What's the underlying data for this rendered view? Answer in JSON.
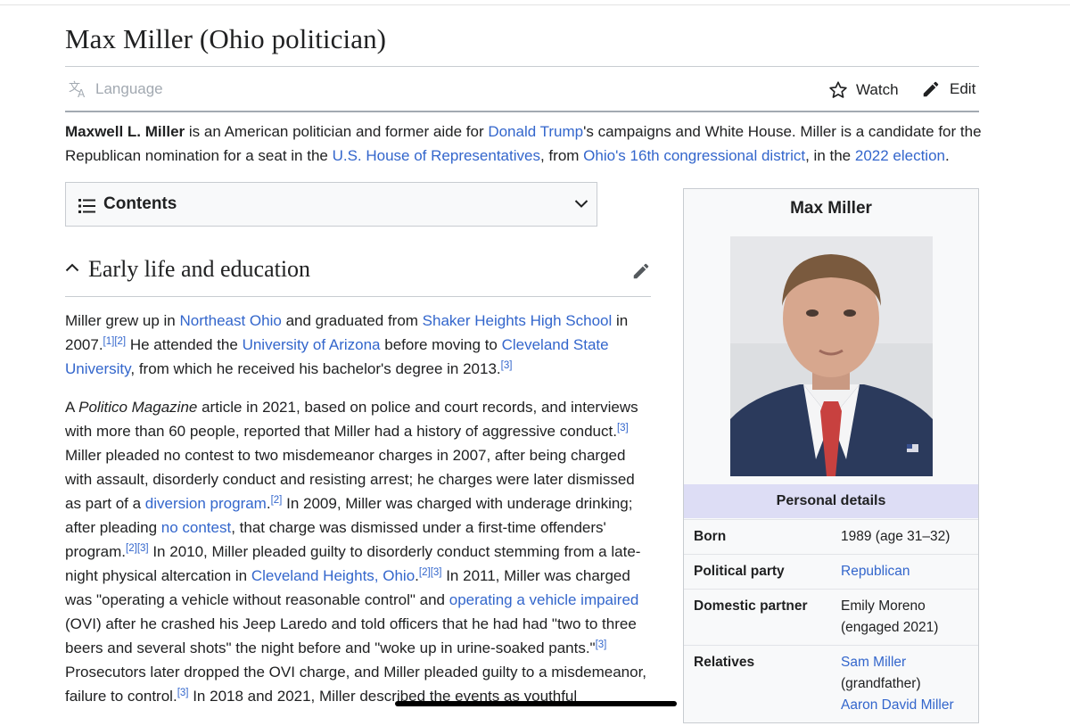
{
  "page": {
    "title": "Max Miller (Ohio politician)"
  },
  "toolbar": {
    "language_label": "Language",
    "watch_label": "Watch",
    "edit_label": "Edit"
  },
  "lead": {
    "name": "Maxwell L. Miller",
    "t1": " is an American politician and former aide for ",
    "link_trump": "Donald Trump",
    "t2": "'s campaigns and White House. Miller is a candidate for the Republican nomination for a seat in the ",
    "link_house": "U.S. House of Representatives",
    "t3": ", from ",
    "link_district": "Ohio's 16th congressional district",
    "t4": ", in the ",
    "link_election": "2022 election",
    "t5": "."
  },
  "toc": {
    "label": "Contents"
  },
  "section": {
    "title": "Early life and education"
  },
  "p1": {
    "t1": "Miller grew up in ",
    "link_ne_ohio": "Northeast Ohio",
    "t2": " and graduated from ",
    "link_shaker": "Shaker Heights High School",
    "t3": " in 2007.",
    "ref1": "[1][2]",
    "t4": " He attended the ",
    "link_arizona": "University of Arizona",
    "t5": " before moving to ",
    "link_csu": "Cleveland State University",
    "t6": ", from which he received his bachelor's degree in 2013.",
    "ref2": "[3]"
  },
  "p2": {
    "t1": "A ",
    "italic": "Politico Magazine",
    "t2": " article in 2021, based on police and court records, and interviews with more than 60 people, reported that Miller had a history of aggressive conduct.",
    "ref1": "[3]",
    "t3": " Miller pleaded no contest to two misdemeanor charges in 2007, after being charged with assault, disorderly conduct and resisting arrest; he charges were later dismissed as part of a ",
    "link_diversion": "diversion program",
    "t4": ".",
    "ref2": "[2]",
    "t5": " In 2009, Miller was charged with underage drinking; after pleading ",
    "link_no_contest": "no contest",
    "t6": ", that charge was dismissed under a first-time offenders' program.",
    "ref3": "[2][3]",
    "t7": " In 2010, Miller pleaded guilty to disorderly conduct stemming from a late-night physical altercation in ",
    "link_cleveland_heights": "Cleveland Heights, Ohio",
    "t8": ".",
    "ref4": "[2][3]",
    "t9": " In 2011, Miller was charged was \"operating a vehicle without reasonable control\" and ",
    "link_ovi": "operating a vehicle impaired",
    "t10": " (OVI) after he crashed his Jeep Laredo and told officers that he had had \"two to three beers and several shots\" the night before and \"woke up in urine-soaked pants.\"",
    "ref5": "[3]",
    "t11": " Prosecutors later dropped the OVI charge, and Miller pleaded guilty to a misdemeanor, failure to control.",
    "ref6": "[3]",
    "t12": " In 2018 and 2021, Miller described the events as youthful"
  },
  "infobox": {
    "title": "Max Miller",
    "section_label": "Personal details",
    "born_label": "Born",
    "born_value": "1989 (age 31–32)",
    "party_label": "Political party",
    "party_value": "Republican",
    "partner_label": "Domestic partner",
    "partner_value_1": "Emily Moreno",
    "partner_value_2": "(engaged 2021)",
    "relatives_label": "Relatives",
    "relative_1": "Sam Miller",
    "relative_1_note": "(grandfather)",
    "relative_2": "Aaron David Miller"
  },
  "colors": {
    "link": "#3366cc",
    "text": "#202122",
    "infobox_header": "#ddddf5"
  }
}
